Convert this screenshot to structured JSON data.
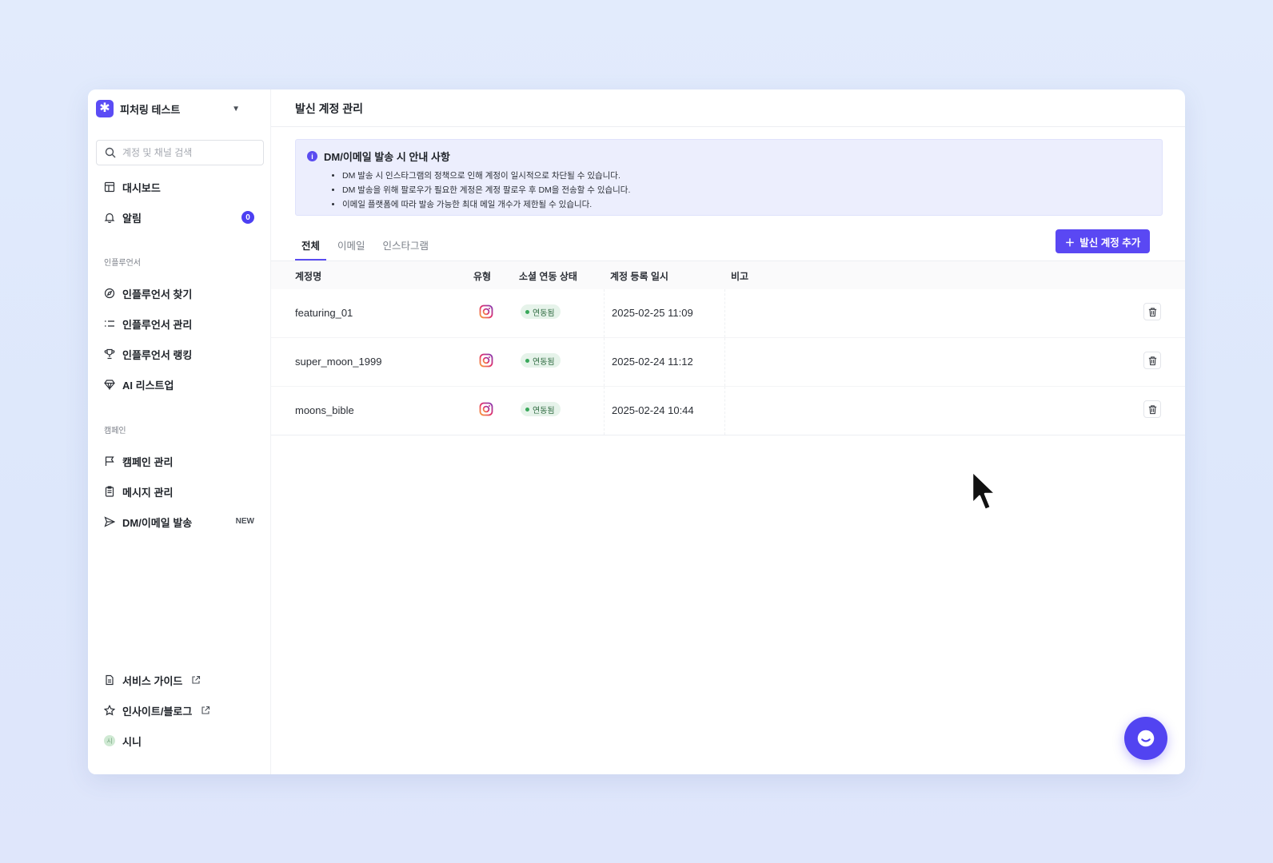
{
  "workspace": {
    "name": "피처링 테스트"
  },
  "search": {
    "placeholder": "계정 및 채널 검색"
  },
  "nav": {
    "dashboard": "대시보드",
    "alerts": "알림",
    "alerts_count": "0",
    "section_influencer": "인플루언서",
    "find_influencer": "인플루언서 찾기",
    "manage_influencer": "인플루언서 관리",
    "ranking": "인플루언서 랭킹",
    "ai_listup": "AI 리스트업",
    "section_campaign": "캠페인",
    "campaign_manage": "캠페인 관리",
    "message_manage": "메시지 관리",
    "dm_email": "DM/이메일 발송",
    "new_tag": "NEW",
    "service_guide": "서비스 가이드",
    "insight_blog": "인사이트/블로그",
    "user_name": "시니",
    "user_avatar": "시"
  },
  "page": {
    "title": "발신 계정 관리"
  },
  "notice": {
    "title": "DM/이메일 발송 시 안내 사항",
    "items": [
      "DM 발송 시 인스타그램의 정책으로 인해 계정이 일시적으로 차단될 수 있습니다.",
      "DM 발송을 위해 팔로우가 필요한 계정은 계정 팔로우 후 DM을 전송할 수 있습니다.",
      "이메일 플랫폼에 따라 발송 가능한 최대 메일 개수가 제한될 수 있습니다."
    ]
  },
  "tabs": [
    "전체",
    "이메일",
    "인스타그램"
  ],
  "add_button": "발신 계정 추가",
  "table": {
    "headers": {
      "name": "계정명",
      "type": "유형",
      "status": "소셜 연동 상태",
      "registered": "계정 등록 일시",
      "note": "비고"
    },
    "rows": [
      {
        "name": "featuring_01",
        "type": "instagram-icon",
        "status": "연동됨",
        "registered": "2025-02-25 11:09"
      },
      {
        "name": "super_moon_1999",
        "type": "instagram-icon",
        "status": "연동됨",
        "registered": "2025-02-24 11:12"
      },
      {
        "name": "moons_bible",
        "type": "instagram-icon",
        "status": "연동됨",
        "registered": "2025-02-24 10:44"
      }
    ]
  },
  "colors": {
    "accent": "#5a48f3",
    "status_bg": "#e6f3ea",
    "status_dot": "#39a85a"
  }
}
